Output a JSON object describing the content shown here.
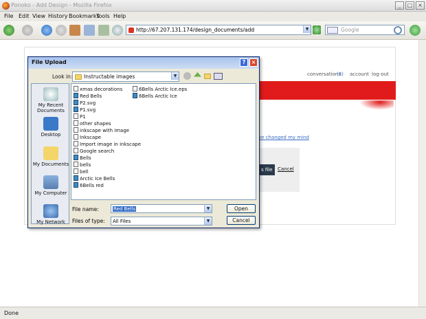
{
  "window": {
    "title": "Ponoko - Add Design - Mozilla Firefox"
  },
  "menu": [
    "File",
    "Edit",
    "View",
    "History",
    "Bookmarks",
    "Tools",
    "Help"
  ],
  "nav": {
    "url": "http://67.207.131.174/design_documents/add",
    "search_placeholder": "Google"
  },
  "page": {
    "links": {
      "conversations": "conversations",
      "count": "(3)",
      "account": "account",
      "logout": "log-out"
    },
    "changed_mind": "ve changed my mind",
    "file_btn": "s file",
    "cancel": "Cancel"
  },
  "dialog": {
    "title": "File Upload",
    "look_in_label": "Look in:",
    "look_in_value": "Instructable images",
    "places": [
      "My Recent Documents",
      "Desktop",
      "My Documents",
      "My Computer",
      "My Network"
    ],
    "files_col1": [
      "xmas decorations",
      "Red Bells",
      "P2.svg",
      "P1.svg",
      "P1",
      "other shapes",
      "inkscape with image",
      "Inkscape",
      "Import image in inkscape",
      "Google search",
      "Bells",
      "bells",
      "bell",
      "Arctic Ice Bells",
      "6Bells red"
    ],
    "files_col2": [
      "6Bells Arctic Ice.eps",
      "6Bells Arctic Ice"
    ],
    "file_name_label": "File name:",
    "file_name_value": "Red Bells",
    "file_type_label": "Files of type:",
    "file_type_value": "All Files",
    "open": "Open",
    "cancel": "Cancel"
  },
  "status": "Done",
  "colors": {
    "accent_red": "#e11b1b",
    "dialog_bg": "#ece9d8",
    "selection": "#316ac5"
  }
}
